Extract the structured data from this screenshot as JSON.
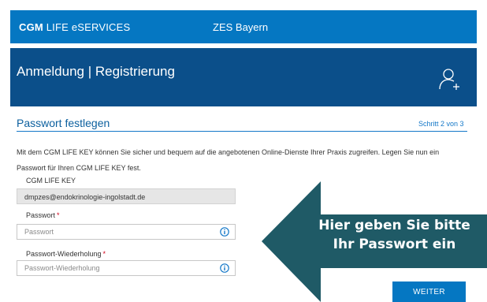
{
  "header": {
    "brand_bold": "CGM",
    "brand_rest": "LIFE eSERVICES",
    "app_name": "ZES Bayern"
  },
  "hero": {
    "title": "Anmeldung | Registrierung",
    "icon": "add-user-icon"
  },
  "section": {
    "title": "Passwort festlegen",
    "step": "Schritt 2 von 3"
  },
  "intro": "Mit dem CGM LIFE KEY können Sie sicher und bequem auf die angebotenen Online-Dienste Ihrer Praxis zugreifen. Legen Sie nun ein Passwort für Ihren CGM LIFE KEY fest.",
  "form": {
    "key_label": "CGM LIFE KEY",
    "key_value": "dmpzes@endokrinologie-ingolstadt.de",
    "password_label": "Passwort",
    "password_placeholder": "Passwort",
    "repeat_label": "Passwort-Wiederholung",
    "repeat_placeholder": "Passwort-Wiederholung",
    "required_mark": "*",
    "info_icon": "info-icon",
    "submit_label": "WEITER"
  },
  "callout": {
    "line1": "Hier geben Sie bitte",
    "line2": "Ihr Passwort ein"
  },
  "colors": {
    "header": "#0577c2",
    "hero": "#0b4f8a",
    "callout": "#1f5a66",
    "required": "#d0021b"
  }
}
